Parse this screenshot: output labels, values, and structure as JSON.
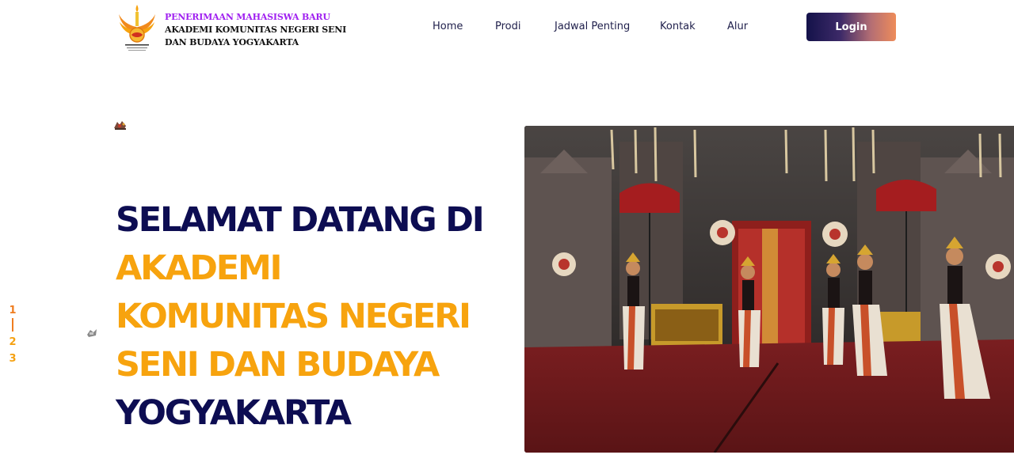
{
  "header": {
    "brand": {
      "line1": "PENERIMAAN MAHASISWA BARU",
      "line2": "AKADEMI KOMUNITAS NEGERI SENI",
      "line3": "DAN BUDAYA YOGYAKARTA"
    },
    "nav": [
      {
        "label": "Home"
      },
      {
        "label": "Prodi"
      },
      {
        "label": "Jadwal Penting"
      },
      {
        "label": "Kontak"
      },
      {
        "label": "Alur"
      }
    ],
    "login_label": "Login"
  },
  "hero": {
    "line1": "SELAMAT DATANG DI",
    "line2": "AKADEMI",
    "line3": "KOMUNITAS NEGERI",
    "line4": "SENI DAN BUDAYA",
    "line5": "YOGYAKARTA"
  },
  "pager": {
    "items": [
      "1",
      "2",
      "3"
    ],
    "active": "1"
  },
  "colors": {
    "navy": "#0d0d52",
    "accent_orange": "#f7a30e",
    "brand_purple": "#a020f0",
    "nav_text": "#1f1f4b",
    "login_gradient_start": "#14124a",
    "login_gradient_end": "#ee8c5a"
  },
  "icons": {
    "logo": "institution-logo-icon",
    "hero_image": "traditional-dancers-photo"
  }
}
